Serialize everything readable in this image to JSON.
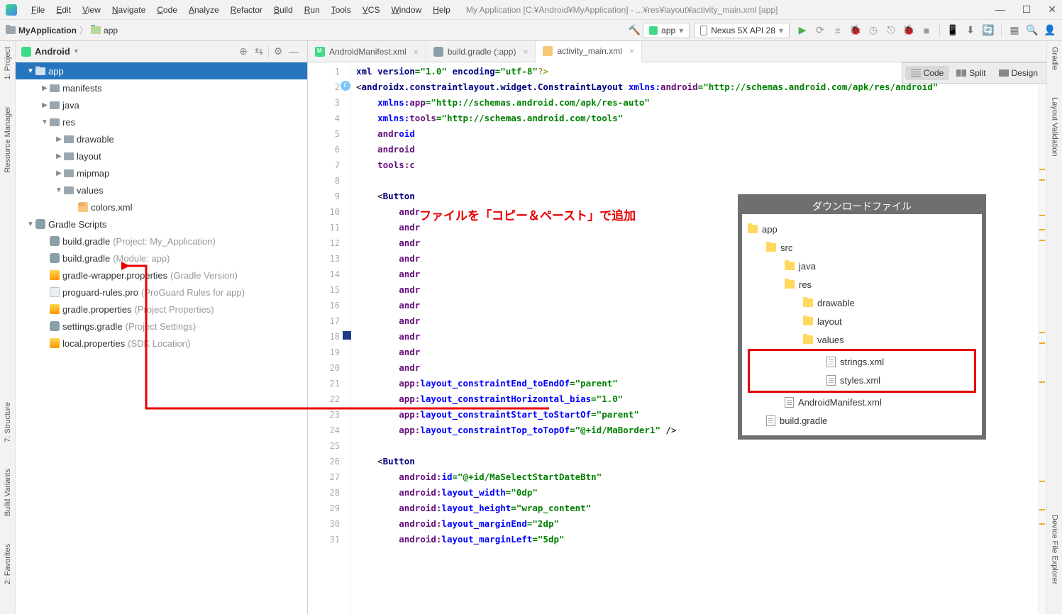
{
  "menu": {
    "items": [
      "File",
      "Edit",
      "View",
      "Navigate",
      "Code",
      "Analyze",
      "Refactor",
      "Build",
      "Run",
      "Tools",
      "VCS",
      "Window",
      "Help"
    ],
    "title": "My Application [C:¥Android¥MyApplication] - ...¥res¥layout¥activity_main.xml [app]"
  },
  "breadcrumb": {
    "root": "MyApplication",
    "module": "app"
  },
  "run_config": {
    "config": "app",
    "device": "Nexus 5X API 28"
  },
  "project_panel": {
    "title": "Android",
    "tree": [
      {
        "depth": 0,
        "arrow": "▼",
        "icon": "module",
        "label": "app",
        "selected": true
      },
      {
        "depth": 1,
        "arrow": "▶",
        "icon": "folder",
        "label": "manifests"
      },
      {
        "depth": 1,
        "arrow": "▶",
        "icon": "folder",
        "label": "java"
      },
      {
        "depth": 1,
        "arrow": "▼",
        "icon": "folder",
        "label": "res"
      },
      {
        "depth": 2,
        "arrow": "▶",
        "icon": "folder",
        "label": "drawable"
      },
      {
        "depth": 2,
        "arrow": "▶",
        "icon": "folder",
        "label": "layout"
      },
      {
        "depth": 2,
        "arrow": "▶",
        "icon": "folder",
        "label": "mipmap"
      },
      {
        "depth": 2,
        "arrow": "▼",
        "icon": "folder",
        "label": "values"
      },
      {
        "depth": 3,
        "arrow": "",
        "icon": "xml",
        "label": "colors.xml"
      },
      {
        "depth": 0,
        "arrow": "▼",
        "icon": "elephant",
        "label": "Gradle Scripts"
      },
      {
        "depth": 1,
        "arrow": "",
        "icon": "elephant",
        "label": "build.gradle",
        "hint": "(Project: My_Application)"
      },
      {
        "depth": 1,
        "arrow": "",
        "icon": "elephant",
        "label": "build.gradle",
        "hint": "(Module: app)"
      },
      {
        "depth": 1,
        "arrow": "",
        "icon": "prop",
        "label": "gradle-wrapper.properties",
        "hint": "(Gradle Version)"
      },
      {
        "depth": 1,
        "arrow": "",
        "icon": "plain",
        "label": "proguard-rules.pro",
        "hint": "(ProGuard Rules for app)"
      },
      {
        "depth": 1,
        "arrow": "",
        "icon": "prop",
        "label": "gradle.properties",
        "hint": "(Project Properties)"
      },
      {
        "depth": 1,
        "arrow": "",
        "icon": "elephant",
        "label": "settings.gradle",
        "hint": "(Project Settings)"
      },
      {
        "depth": 1,
        "arrow": "",
        "icon": "prop",
        "label": "local.properties",
        "hint": "(SDK Location)"
      }
    ]
  },
  "tabs": [
    {
      "icon": "mf",
      "label": "AndroidManifest.xml",
      "active": false,
      "close": true
    },
    {
      "icon": "elephant",
      "label": "build.gradle (:app)",
      "active": false,
      "close": true
    },
    {
      "icon": "xml",
      "label": "activity_main.xml",
      "active": true,
      "close": true
    }
  ],
  "view_modes": {
    "code": "Code",
    "split": "Split",
    "design": "Design"
  },
  "gutter": {
    "lines": 31,
    "marker_c_line": 2,
    "marker_sq_line": 18
  },
  "popup": {
    "title": "ダウンロードファイル",
    "tree": [
      {
        "d": 0,
        "icon": "folder",
        "label": "app"
      },
      {
        "d": 1,
        "icon": "folder",
        "label": "src"
      },
      {
        "d": 2,
        "icon": "folder",
        "label": "java"
      },
      {
        "d": 2,
        "icon": "folder",
        "label": "res"
      },
      {
        "d": 3,
        "icon": "folder",
        "label": "drawable"
      },
      {
        "d": 3,
        "icon": "folder",
        "label": "layout"
      },
      {
        "d": 3,
        "icon": "folder",
        "label": "values"
      },
      {
        "d": 4,
        "icon": "file",
        "label": "strings.xml",
        "red": true
      },
      {
        "d": 4,
        "icon": "file",
        "label": "styles.xml",
        "red": true
      },
      {
        "d": 2,
        "icon": "file",
        "label": "AndroidManifest.xml"
      },
      {
        "d": 1,
        "icon": "file",
        "label": "build.gradle"
      }
    ]
  },
  "annotation": "ファイルを「コピー＆ペースト」で追加",
  "left_rail": [
    "1: Project",
    "Resource Manager",
    "7: Structure",
    "Build Variants",
    "2: Favorites"
  ],
  "right_rail": [
    "Gradle",
    "Layout Validation",
    "Device File Explorer"
  ],
  "code": {
    "l1_a": "<?",
    "l1_b": "xml version",
    "l1_c": "=\"1.0\"",
    "l1_d": " encoding",
    "l1_e": "=\"utf-8\"",
    "l1_f": "?>",
    "l2_a": "<",
    "l2_b": "androidx.constraintlayout.widget.ConstraintLayout",
    "l2_c": " xmlns:",
    "l2_d": "android",
    "l2_e": "=\"http://schemas.android.com/apk/res/android\"",
    "l3_a": "xmlns:",
    "l3_b": "app",
    "l3_c": "=\"http://schemas.android.com/apk/res-auto\"",
    "l4_a": "xmlns:",
    "l4_ns": "to",
    "l4_b": "ols",
    "l4_c": "=\"http://schemas.android.com/tools\"",
    "l5_a": "andr",
    "l5_b": "oid",
    "l6_a": "android",
    "l7_a": "tools:c",
    "l8_a": "",
    "l9_a": "<",
    "l9_b": "Button",
    "l10": "andr",
    "l11": "andr",
    "l12": "andr",
    "l13": "andr",
    "l14": "andr",
    "l15": "andr",
    "l16": "andr",
    "l17": "andr",
    "l18": "andr",
    "l19": "andr",
    "l20": "andr",
    "l21_a": "app:",
    "l21_b": "layout_constraintEnd_toEndOf",
    "l21_c": "=\"parent\"",
    "l22_a": "app:",
    "l22_b": "layout_constraintHorizontal_bias",
    "l22_c": "=\"1.0\"",
    "l23_a": "app:",
    "l23_b": "layout_constraintStart_toStartOf",
    "l23_c": "=\"parent\"",
    "l24_a": "app:",
    "l24_b": "layout_constraintTop_toTopOf",
    "l24_c": "=\"@+id/MaBorder1\"",
    "l24_d": " />",
    "l26_a": "<",
    "l26_b": "Button",
    "l27_a": "android:",
    "l27_b": "id",
    "l27_c": "=\"@+id/MaSelectStartDateBtn\"",
    "l28_a": "android:",
    "l28_b": "layout_width",
    "l28_c": "=\"0dp\"",
    "l29_a": "android:",
    "l29_b": "layout_height",
    "l29_c": "=\"wrap_content\"",
    "l30_a": "android:",
    "l30_b": "layout_marginEnd",
    "l30_c": "=\"2dp\"",
    "l31_a": "android:",
    "l31_b": "layout_marginLeft",
    "l31_c": "=\"5dp\""
  }
}
